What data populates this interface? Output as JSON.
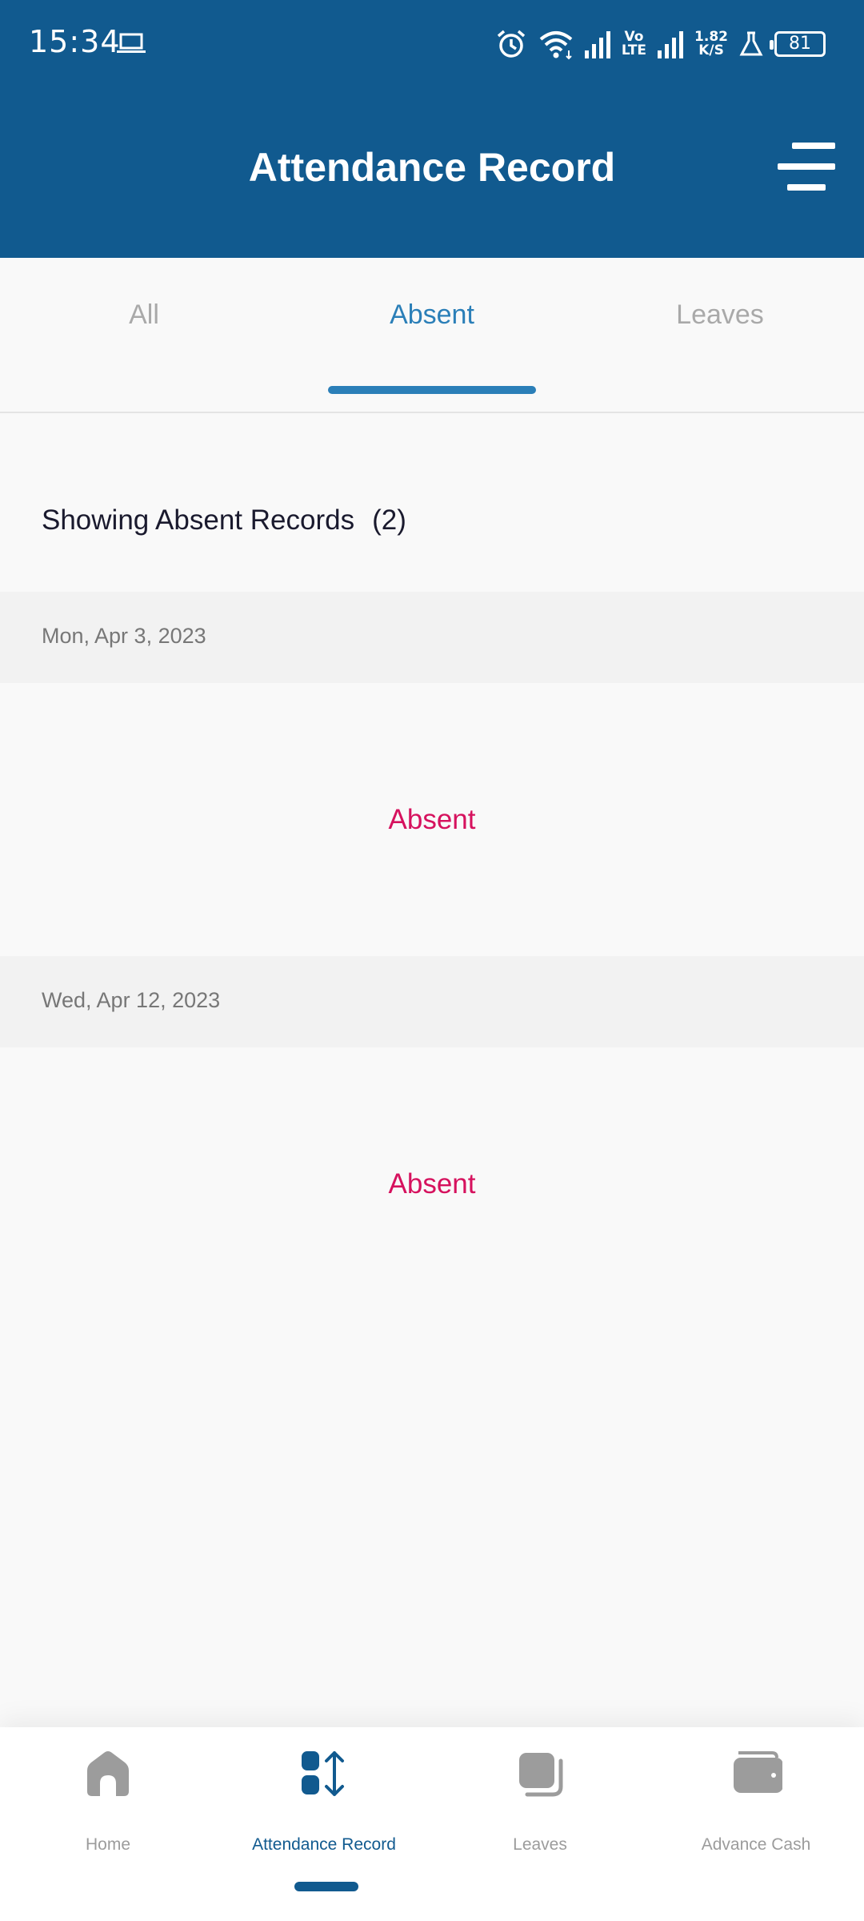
{
  "status_bar": {
    "time": "15:34",
    "volte_top": "Vo",
    "volte_bottom": "LTE",
    "speed_value": "1.82",
    "speed_unit": "K/S",
    "battery": "81"
  },
  "header": {
    "title": "Attendance Record"
  },
  "tabs": [
    {
      "label": "All",
      "active": false
    },
    {
      "label": "Absent",
      "active": true
    },
    {
      "label": "Leaves",
      "active": false
    }
  ],
  "summary": {
    "label": "Showing Absent Records",
    "count": "(2)"
  },
  "records": [
    {
      "date": "Mon, Apr 3, 2023",
      "status": "Absent"
    },
    {
      "date": "Wed, Apr 12, 2023",
      "status": "Absent"
    }
  ],
  "bottom_nav": [
    {
      "label": "Home",
      "icon": "home-icon",
      "active": false
    },
    {
      "label": "Attendance Record",
      "icon": "attendance-icon",
      "active": true
    },
    {
      "label": "Leaves",
      "icon": "leaves-icon",
      "active": false
    },
    {
      "label": "Advance Cash",
      "icon": "wallet-icon",
      "active": false
    }
  ],
  "colors": {
    "primary": "#115a8f",
    "tab_active": "#2b7fb8",
    "absent": "#d6125e",
    "inactive": "#9c9c9c"
  }
}
